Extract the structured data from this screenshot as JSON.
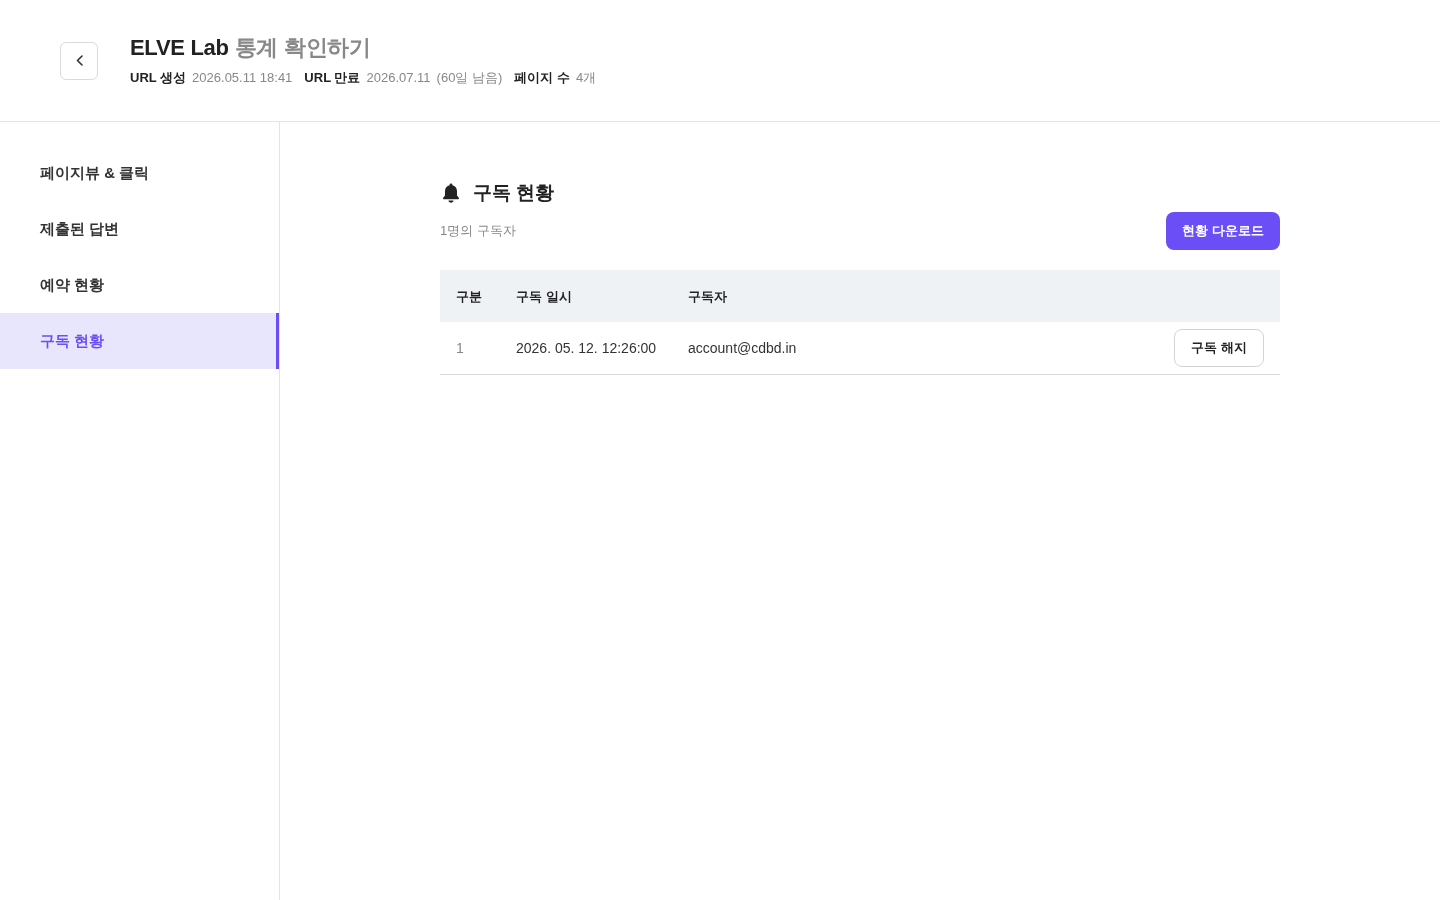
{
  "header": {
    "title": "ELVE Lab",
    "title_suffix": "통계 확인하기",
    "meta": [
      {
        "label": "URL 생성",
        "value": "2026.05.11 18:41"
      },
      {
        "label": "URL 만료",
        "value": "2026.07.11",
        "note": "(60일 남음)"
      },
      {
        "label": "페이지 수",
        "value": "4개"
      }
    ]
  },
  "sidebar": {
    "items": [
      {
        "label": "페이지뷰 & 클릭",
        "selected": false
      },
      {
        "label": "제출된 답변",
        "selected": false
      },
      {
        "label": "예약 현황",
        "selected": false
      },
      {
        "label": "구독 현황",
        "selected": true
      }
    ]
  },
  "main": {
    "title": "구독 현황",
    "subtitle": "1명의 구독자",
    "download_button": "현황 다운로드",
    "table": {
      "columns": [
        "구분",
        "구독 일시",
        "구독자"
      ],
      "rows": [
        {
          "cells": [
            "1",
            "2026. 05. 12. 12:26:00",
            "account@cdbd.in"
          ],
          "action": "구독 해지"
        }
      ]
    }
  }
}
